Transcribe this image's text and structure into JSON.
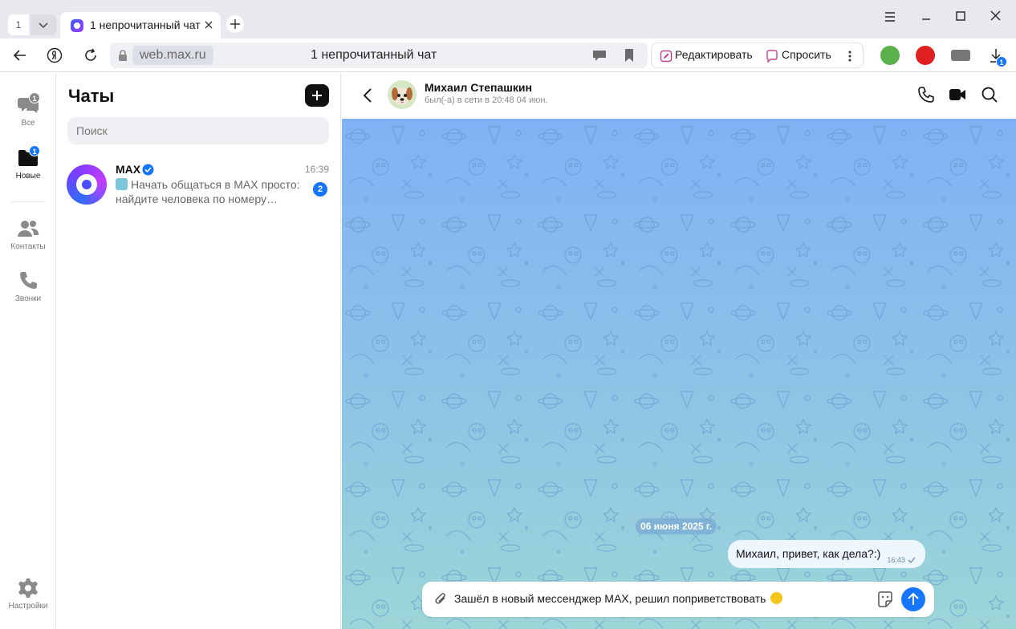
{
  "browser": {
    "tab_count": "1",
    "tab_title": "1 непрочитанный чат",
    "url_domain": "web.max.ru",
    "page_title": "1 непрочитанный чат",
    "edit_label": "Редактировать",
    "ask_label": "Спросить",
    "downloads_badge": "1",
    "icons": [
      "back-arrow-icon",
      "yandex-icon",
      "reload-icon",
      "lock-icon",
      "reader-icon",
      "bookmark-icon",
      "menu-icon",
      "minimize-icon",
      "maximize-icon",
      "close-icon",
      "download-icon"
    ]
  },
  "rail": {
    "items": [
      {
        "label": "Все",
        "badge": "1",
        "icon": "chats-icon"
      },
      {
        "label": "Новые",
        "badge": "1",
        "icon": "folder-icon"
      },
      {
        "label": "Контакты",
        "icon": "contacts-icon"
      },
      {
        "label": "Звонки",
        "icon": "phone-icon"
      },
      {
        "label": "Настройки",
        "icon": "gear-icon"
      }
    ]
  },
  "chat_list": {
    "title": "Чаты",
    "search_placeholder": "Поиск",
    "chats": [
      {
        "name": "MAX",
        "verified": true,
        "time": "16:39",
        "preview": "Начать общаться в MAX просто: найдите человека по номеру…",
        "unread": "2"
      }
    ]
  },
  "conversation": {
    "contact_name": "Михаил Степашкин",
    "contact_status": "был(-а) в сети в 20:48 04 июн.",
    "date_separator": "06 июня 2025 г.",
    "messages": [
      {
        "text": "Михаил, привет, как дела?:)",
        "time": "16:43",
        "outgoing": true,
        "status": "sent"
      }
    ],
    "composer_text": "Зашёл в новый мессенджер MAX, решил поприветствовать"
  },
  "colors": {
    "accent": "#1676ff",
    "chat_bg_top": "#7fb2f5",
    "chat_bg_bottom": "#9cd5d8"
  }
}
